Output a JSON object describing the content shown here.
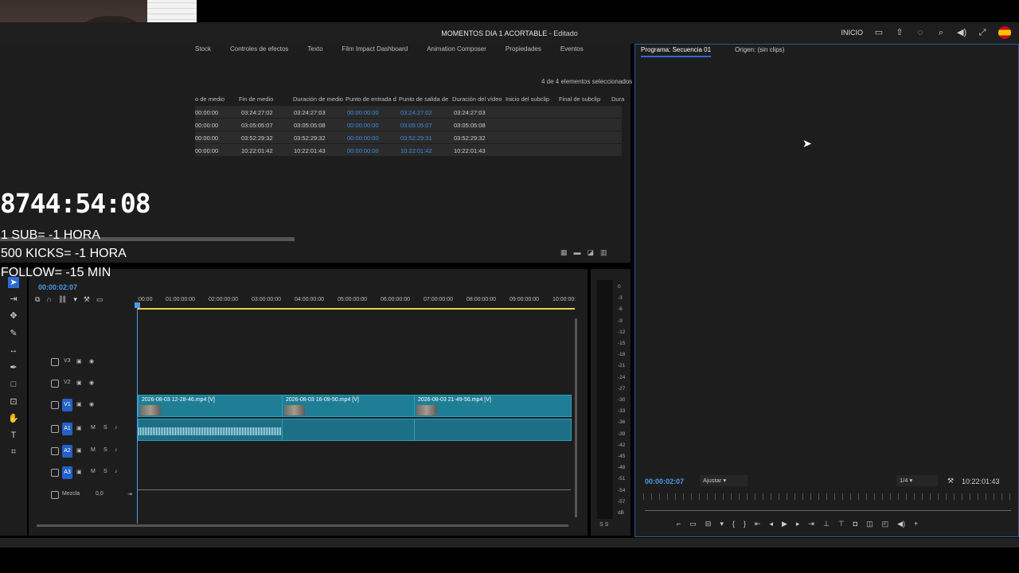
{
  "window": {
    "title": "MOMENTOS DIA 1 ACORTABLE",
    "subtitle": "- Editado",
    "workspace": "INICIO"
  },
  "top_icons": [
    "layout-icon",
    "export-icon",
    "progress-icon",
    "search-icon",
    "volume-icon",
    "fullscreen-icon",
    "flag-spain-icon"
  ],
  "left_tabs": [
    "Stock",
    "Controles de efectos",
    "Texto",
    "Film Impact Dashboard",
    "Animation Composer",
    "Propiedades",
    "Eventos"
  ],
  "selection_count": "4 de 4 elementos seleccionados",
  "table": {
    "headers": [
      "o de medio",
      "Fin de medio",
      "Duración de medio",
      "Punto de entrada d",
      "Punto de salida de",
      "Duración del vídeo",
      "Inicio del subclip",
      "Final de subclip",
      "Dura"
    ],
    "rows": [
      [
        "00:00:00",
        "03:24:27:02",
        "03:24:27:03",
        "00:00:00:00",
        "03:24:27:02",
        "03:24:27:03"
      ],
      [
        "00:00:00",
        "03:05:05:07",
        "03:05:05:08",
        "00:00:00:00",
        "03:05:05:07",
        "03:05:05:08"
      ],
      [
        "00:00:00",
        "03:52:29:32",
        "03:52:29:32",
        "00:00:00:00",
        "03:52:29:31",
        "03:52:29:32"
      ],
      [
        "00:00:00",
        "10:22:01:42",
        "10:22:01:43",
        "00:00:00:00",
        "10:22:01:42",
        "10:22:01:43"
      ]
    ]
  },
  "overlay": {
    "timer": "8744:54:08",
    "lines": [
      "1 SUB= -1 HORA",
      "500 KICKS= -1 HORA",
      "FOLLOW= -15 MIN"
    ]
  },
  "timeline": {
    "timecode": "00:00:02:07",
    "ruler": [
      ":00:00",
      "01:00:00:00",
      "02:00:00:00",
      "03:00:00:00",
      "04:00:00:00",
      "05:00:00:00",
      "06:00:00:00",
      "07:00:00:00",
      "08:00:00:00",
      "09:00:00:00",
      "10:00:00:"
    ],
    "video_tracks": [
      "V3",
      "V2",
      "V1"
    ],
    "audio_tracks": [
      "A1",
      "A2",
      "A3"
    ],
    "mix_label": "Mezcla",
    "mix_value": "0,0",
    "clips": [
      "2026-08-03 12-28-46.mp4 [V]",
      "2026-08-03 16-09-50.mp4 [V]",
      "2026-08-03 21-49-56.mp4 [V]"
    ],
    "track_btn_m": "M",
    "track_btn_s": "S"
  },
  "meter_scale": [
    "0",
    "-3",
    "-6",
    "-9",
    "-12",
    "-15",
    "-18",
    "-21",
    "-24",
    "-27",
    "-30",
    "-33",
    "-36",
    "-39",
    "-42",
    "-45",
    "-48",
    "-51",
    "-54",
    "-57",
    "dB"
  ],
  "meter_bottom": "S  S",
  "program": {
    "tab_active": "Programa: Secuencia 01",
    "tab_other": "Origen: (sin clips)",
    "timecode": "00:00:02:07",
    "fit": "Ajustar",
    "resolution": "1/4",
    "duration": "10:22:01:43"
  },
  "colors": {
    "accent": "#2d6ad4",
    "timecode": "#4b9be8",
    "clip": "#1e7e95",
    "ruler_line": "#e8d44a"
  }
}
